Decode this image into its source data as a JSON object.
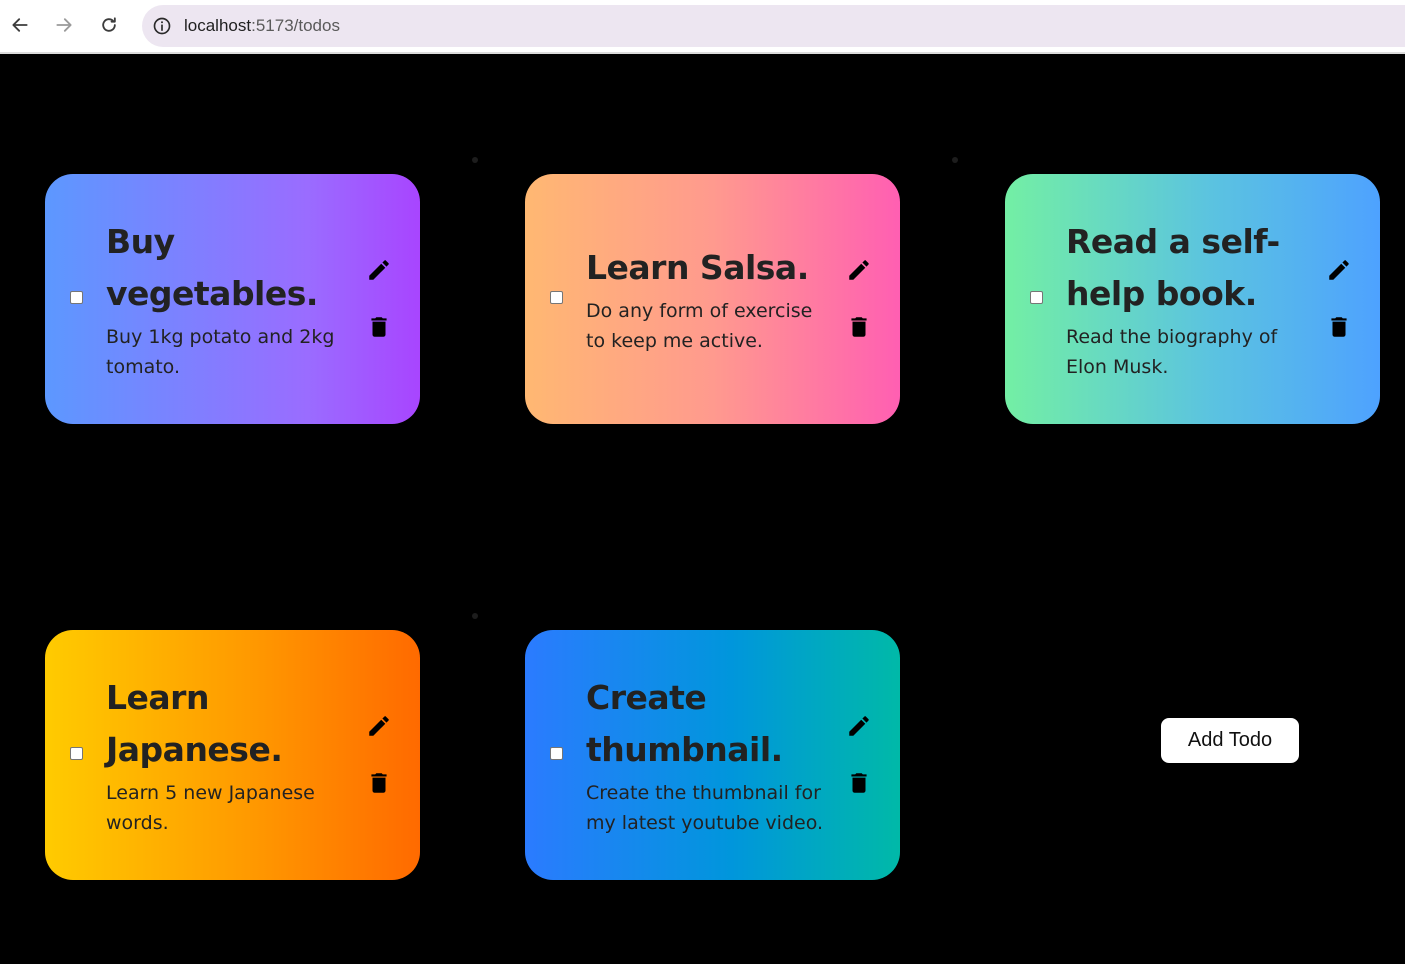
{
  "browser": {
    "url_host": "localhost",
    "url_path": ":5173/todos"
  },
  "todos": [
    {
      "title": "Buy vegetables.",
      "description": "Buy 1kg potato and 2kg tomato.",
      "completed": false
    },
    {
      "title": "Learn Salsa.",
      "description": "Do any form of exercise to keep me active.",
      "completed": false
    },
    {
      "title": "Read a self-help book.",
      "description": "Read the biography of Elon Musk.",
      "completed": false
    },
    {
      "title": "Learn Japanese.",
      "description": "Learn 5 new Japanese words.",
      "completed": false
    },
    {
      "title": "Create thumbnail.",
      "description": "Create the thumbnail for my latest youtube video.",
      "completed": false
    }
  ],
  "actions": {
    "add_label": "Add Todo"
  },
  "icons": {
    "edit": "pencil-icon",
    "delete": "trash-icon"
  },
  "colors": {
    "background": "#000000",
    "card1": [
      "#5c98ff",
      "#a845ff"
    ],
    "card2": [
      "#ffb872",
      "#ff5fb2"
    ],
    "card3": [
      "#73efa4",
      "#4ea2ff"
    ],
    "card4": [
      "#ffcb00",
      "#ff6a00"
    ],
    "card5": [
      "#2b7bff",
      "#00b9a8"
    ]
  }
}
